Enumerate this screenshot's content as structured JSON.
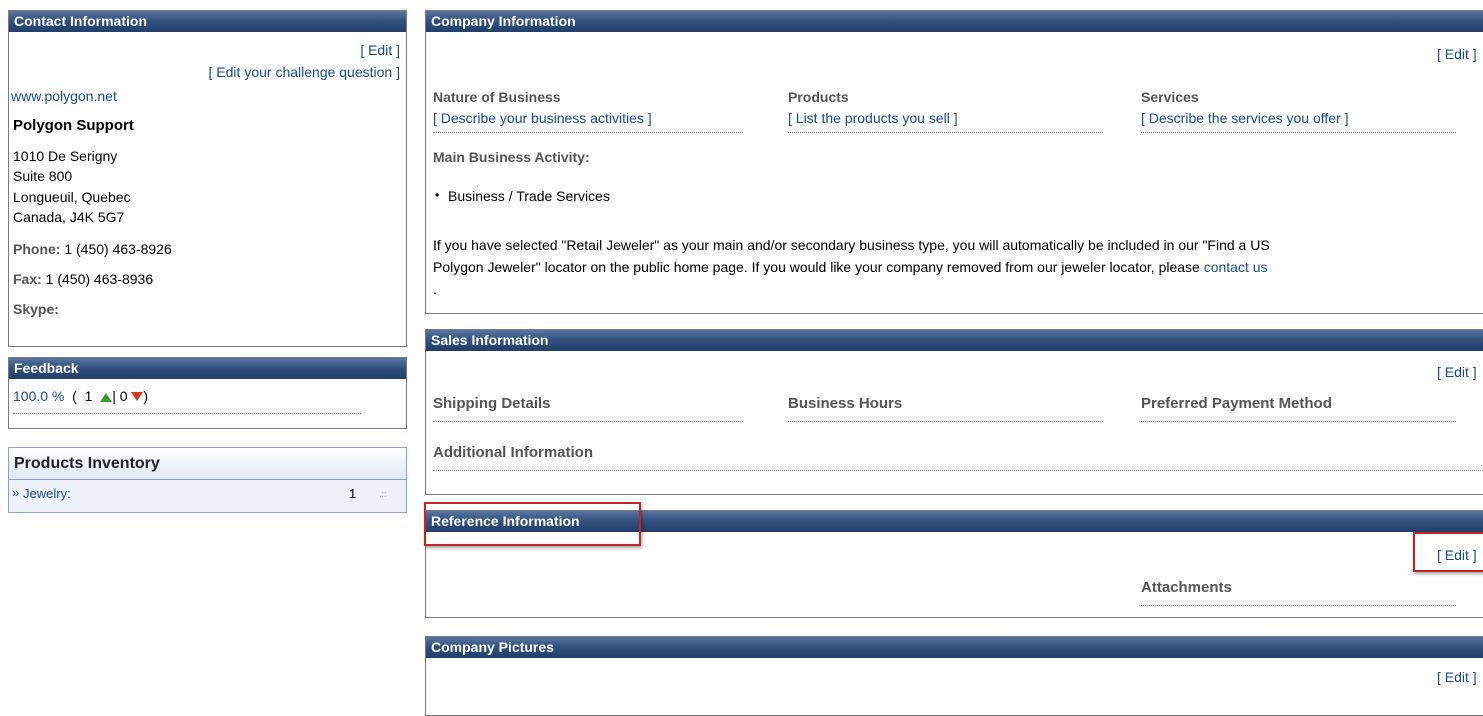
{
  "contact": {
    "title": "Contact Information",
    "edit": "[ Edit ]",
    "challenge": "[ Edit your challenge question ]",
    "website": "www.polygon.net",
    "name": "Polygon Support",
    "address": [
      "1010 De Serigny",
      "Suite 800",
      "Longueuil,  Quebec",
      "Canada,  J4K 5G7"
    ],
    "phone_label": "Phone:",
    "phone_value": " 1  (450) 463-8926",
    "fax_label": "Fax:",
    "fax_value": " 1  (450) 463-8936",
    "skype_label": "Skype:"
  },
  "feedback": {
    "title": "Feedback",
    "percent": "100.0 %",
    "open": "(",
    "positive": "1",
    "sep": "|",
    "negative": "0",
    "close": ")",
    "colors": {
      "positive": "#3a9a2a",
      "negative": "#d43a1e"
    }
  },
  "inventory": {
    "title": "Products Inventory",
    "items": [
      {
        "marker": "»",
        "label": "Jewelry:",
        "count": "1"
      }
    ]
  },
  "company": {
    "title": "Company Information",
    "edit": "[ Edit ]",
    "nature_label": "Nature of Business",
    "nature_link": "[ Describe your business activities ]",
    "products_label": "Products",
    "products_link": "[ List the products you sell ]",
    "services_label": "Services",
    "services_link": "[ Describe the services you offer ]",
    "main_activity_label": "Main Business Activity:",
    "main_activity_value": "Business / Trade Services",
    "notice_line1": "If you have selected \"Retail Jeweler\" as your main and/or secondary business type, you will automatically be included in our \"Find a US",
    "notice_line2": "Polygon Jeweler\" locator on the public home page. If you would like your company removed from our jeweler locator, please",
    "notice_link": "contact us",
    "notice_end": "."
  },
  "sales": {
    "title": "Sales Information",
    "edit": "[ Edit ]",
    "shipping": "Shipping Details",
    "hours": "Business Hours",
    "payment": "Preferred Payment Method",
    "additional": "Additional Information"
  },
  "reference": {
    "title": "Reference Information",
    "edit": "[ Edit ]",
    "attachments": "Attachments"
  },
  "pictures": {
    "title": "Company Pictures",
    "edit": "[ Edit ]"
  },
  "colors": {
    "header": "#2f4d7a",
    "link": "#1a4a8a",
    "highlight": "#c4232a"
  }
}
